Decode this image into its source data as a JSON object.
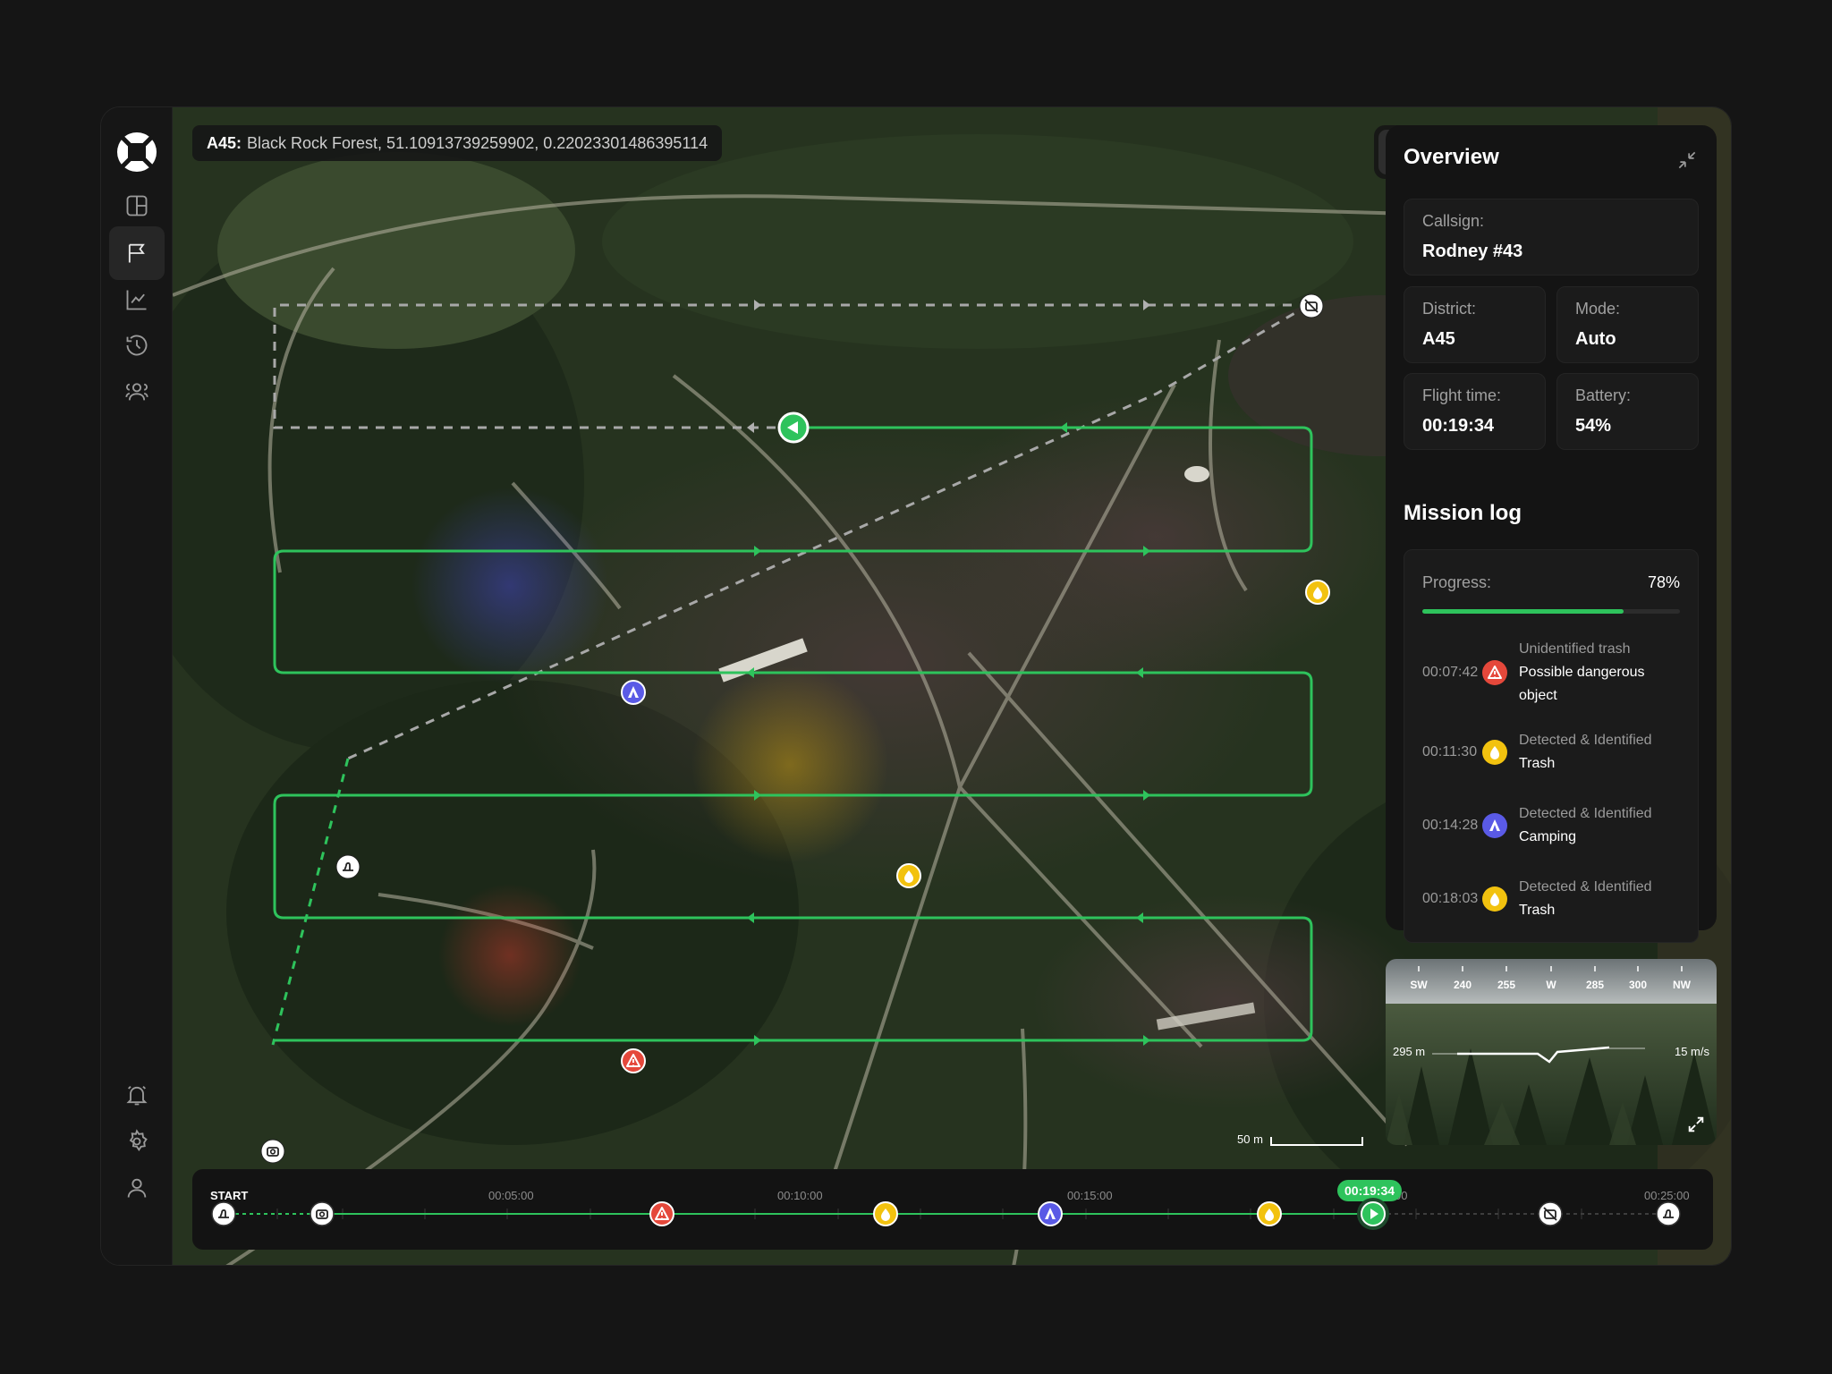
{
  "location": {
    "district": "A45:",
    "text": "Black Rock Forest, 51.10913739259902, 0.22023301486395114"
  },
  "sidebar": {
    "items": [
      {
        "name": "dashboard",
        "icon": "layout-icon"
      },
      {
        "name": "missions",
        "icon": "flag-icon"
      },
      {
        "name": "analytics",
        "icon": "chart-icon"
      },
      {
        "name": "history",
        "icon": "history-icon"
      },
      {
        "name": "team",
        "icon": "users-icon"
      }
    ],
    "bottom": [
      {
        "name": "notifications",
        "icon": "bell-icon"
      },
      {
        "name": "settings",
        "icon": "gear-icon"
      },
      {
        "name": "profile",
        "icon": "user-icon"
      }
    ]
  },
  "map_controls": {
    "view_modes": [
      "map-icon",
      "cube-icon"
    ],
    "locate": "target-icon",
    "zoom_in": "+",
    "zoom_out": "−"
  },
  "scale": {
    "label": "50 m"
  },
  "overview": {
    "title": "Overview",
    "callsign_label": "Callsign:",
    "callsign": "Rodney #43",
    "district_label": "District:",
    "district": "A45",
    "mode_label": "Mode:",
    "mode": "Auto",
    "flight_time_label": "Flight time:",
    "flight_time": "00:19:34",
    "battery_label": "Battery:",
    "battery": "54%"
  },
  "mission_log": {
    "title": "Mission log",
    "progress_label": "Progress:",
    "progress_text": "78%",
    "progress": 0.78,
    "entries": [
      {
        "time": "00:07:42",
        "type": "danger",
        "line1": "Unidentified trash",
        "line2": "Possible dangerous",
        "line3": "object"
      },
      {
        "time": "00:11:30",
        "type": "trash",
        "line1": "Detected & Identified",
        "line2": "Trash"
      },
      {
        "time": "00:14:28",
        "type": "camping",
        "line1": "Detected & Identified",
        "line2": "Camping"
      },
      {
        "time": "00:18:03",
        "type": "trash",
        "line1": "Detected & Identified",
        "line2": "Trash"
      }
    ]
  },
  "camera": {
    "compass": [
      "SW",
      "240",
      "255",
      "W",
      "285",
      "300",
      "NW"
    ],
    "altitude": "295 m",
    "speed": "15 m/s"
  },
  "timeline": {
    "start": "START",
    "ticks": [
      "00:05:00",
      "00:10:00",
      "00:15:00",
      "00:25:00"
    ],
    "tick_partial": "00",
    "current": "00:19:34"
  },
  "colors": {
    "accent": "#2ec35c",
    "danger": "#e5483b",
    "trash": "#f2c20f",
    "camping": "#5a5ae6"
  }
}
